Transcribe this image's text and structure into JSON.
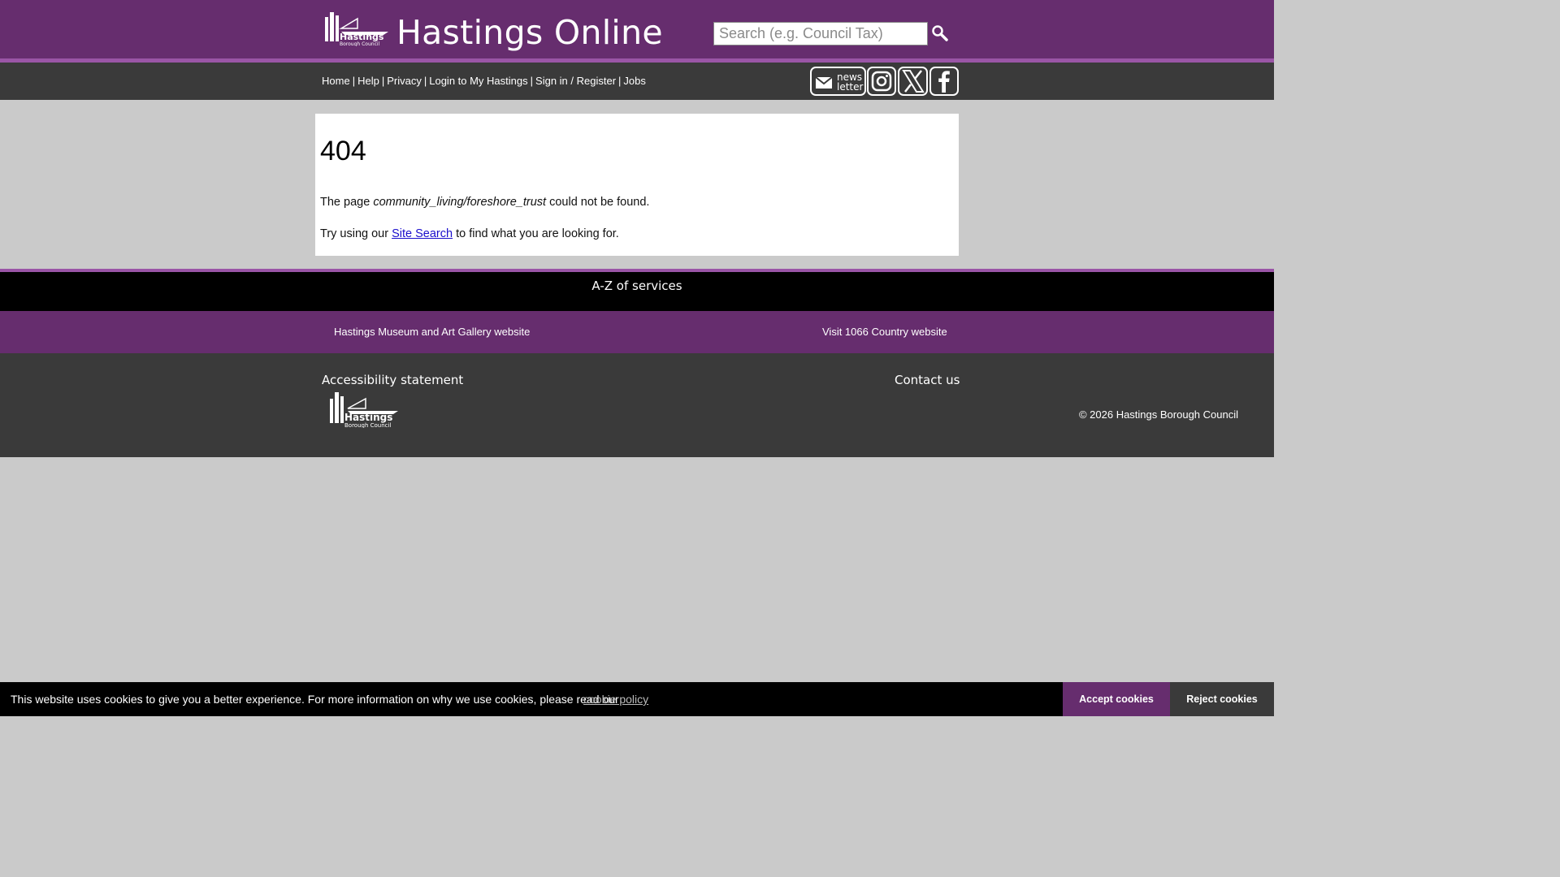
{
  "header": {
    "site_title": "Hastings Online",
    "search_placeholder": "Search (e.g. Council Tax)",
    "search_button_icon": "search-icon"
  },
  "nav": {
    "links": [
      "Home",
      "Help",
      "Privacy",
      "Login to My Hastings",
      "Sign in / Register",
      "Jobs"
    ],
    "separator": "|",
    "social": [
      {
        "name": "newsletter",
        "label": "news letter",
        "icon": "newsletter-icon"
      },
      {
        "name": "instagram",
        "icon": "instagram-icon"
      },
      {
        "name": "x",
        "icon": "x-icon"
      },
      {
        "name": "facebook",
        "icon": "facebook-icon"
      }
    ]
  },
  "main": {
    "heading": "404",
    "message_prefix": "The page ",
    "missing_path": "community_living/foreshore_trust",
    "message_suffix": " could not be found.",
    "search_prefix": "Try using our ",
    "search_link": "Site Search",
    "search_suffix": " to find what you are looking for."
  },
  "footer": {
    "az_link": "A-Z of services",
    "museum_link": "Hastings Museum and Art Gallery website",
    "country_link": "Visit 1066 Country website",
    "accessibility_link": "Accessibility statement",
    "contact_link": "Contact us",
    "copyright": "© 2026 Hastings Borough Council"
  },
  "cookie": {
    "text": "This website uses cookies to give you a better experience. For more information on why we use cookies, please read our",
    "policy_link": "cookie policy",
    "accept_label": "Accept cookies",
    "reject_label": "Reject cookies"
  },
  "colors": {
    "brand_purple": "#662d6e",
    "stripe_purple": "#9a55a6",
    "dark_grey": "#3a3a3a",
    "page_bg": "#cacaca"
  }
}
